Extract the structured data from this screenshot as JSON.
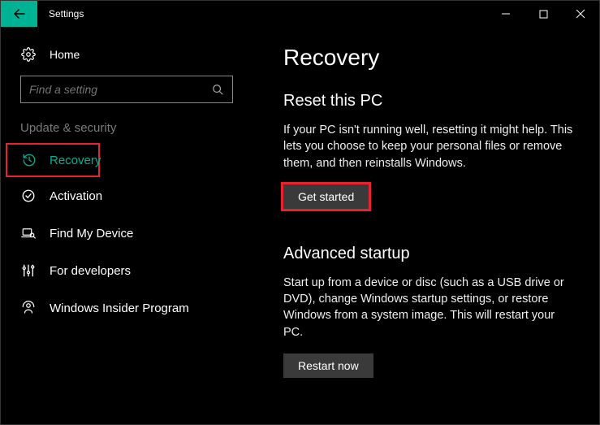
{
  "titlebar": {
    "title": "Settings"
  },
  "sidebar": {
    "home_label": "Home",
    "search_placeholder": "Find a setting",
    "category": "Update & security",
    "items": [
      {
        "label": "Recovery"
      },
      {
        "label": "Activation"
      },
      {
        "label": "Find My Device"
      },
      {
        "label": "For developers"
      },
      {
        "label": "Windows Insider Program"
      }
    ]
  },
  "main": {
    "title": "Recovery",
    "reset": {
      "heading": "Reset this PC",
      "para": "If your PC isn't running well, resetting it might help. This lets you choose to keep your personal files or remove them, and then reinstalls Windows.",
      "button": "Get started"
    },
    "startup": {
      "heading": "Advanced startup",
      "para": "Start up from a device or disc (such as a USB drive or DVD), change Windows startup settings, or restore Windows from a system image. This will restart your PC.",
      "button": "Restart now"
    }
  }
}
